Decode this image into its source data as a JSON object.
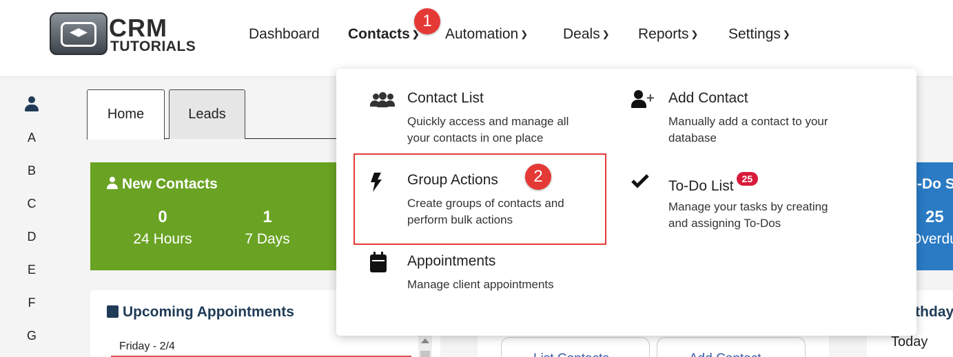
{
  "logo": {
    "line1": "CRM",
    "line2": "TUTORIALS"
  },
  "nav": [
    {
      "label": "Dashboard",
      "has_chevron": false,
      "active": false
    },
    {
      "label": "Contacts",
      "has_chevron": true,
      "active": true
    },
    {
      "label": "Automation",
      "has_chevron": true,
      "active": false
    },
    {
      "label": "Deals",
      "has_chevron": true,
      "active": false
    },
    {
      "label": "Reports",
      "has_chevron": true,
      "active": false
    },
    {
      "label": "Settings",
      "has_chevron": true,
      "active": false
    }
  ],
  "step_markers": [
    "1",
    "2"
  ],
  "alphabet": [
    "A",
    "B",
    "C",
    "D",
    "E",
    "F",
    "G"
  ],
  "tabs": [
    {
      "label": "Home",
      "active": true
    },
    {
      "label": "Leads",
      "active": false
    }
  ],
  "new_contacts": {
    "title": "New Contacts",
    "color": "#6aa323",
    "stats": [
      {
        "value": "0",
        "label": "24 Hours"
      },
      {
        "value": "1",
        "label": "7 Days"
      }
    ]
  },
  "todo_summary": {
    "title_partial": "-Do S",
    "value": "25",
    "label_partial": "Overdu",
    "color": "#2a7bc4"
  },
  "upcoming_appointments": {
    "title": "Upcoming Appointments",
    "first_day": "Friday - 2/4"
  },
  "quick_buttons": [
    {
      "label": "List Contacts",
      "icon": "users-icon"
    },
    {
      "label": "Add Contact",
      "icon": "add-user-icon"
    }
  ],
  "birthdays": {
    "title_partial": "rthday",
    "today": "Today"
  },
  "dropdown": {
    "items": [
      {
        "title": "Contact List",
        "desc1": "Quickly access and manage all",
        "desc2": "your contacts in one place",
        "icon": "users-icon"
      },
      {
        "title": "Add Contact",
        "desc1": "Manually add a contact to your",
        "desc2": "database",
        "icon": "add-user-icon"
      },
      {
        "title": "Group Actions",
        "desc1": "Create groups of contacts and",
        "desc2": "perform bulk actions",
        "icon": "lightning-bolt-icon"
      },
      {
        "title": "To-Do List",
        "badge": "25",
        "desc1": "Manage your tasks by creating",
        "desc2": "and assigning To-Dos",
        "icon": "checkmark-icon"
      },
      {
        "title": "Appointments",
        "desc1": "Manage client appointments",
        "desc2": "",
        "icon": "calendar-icon"
      }
    ]
  },
  "colors": {
    "highlight": "#e53935",
    "badge": "#d81b3c",
    "marker": "#e53935"
  }
}
